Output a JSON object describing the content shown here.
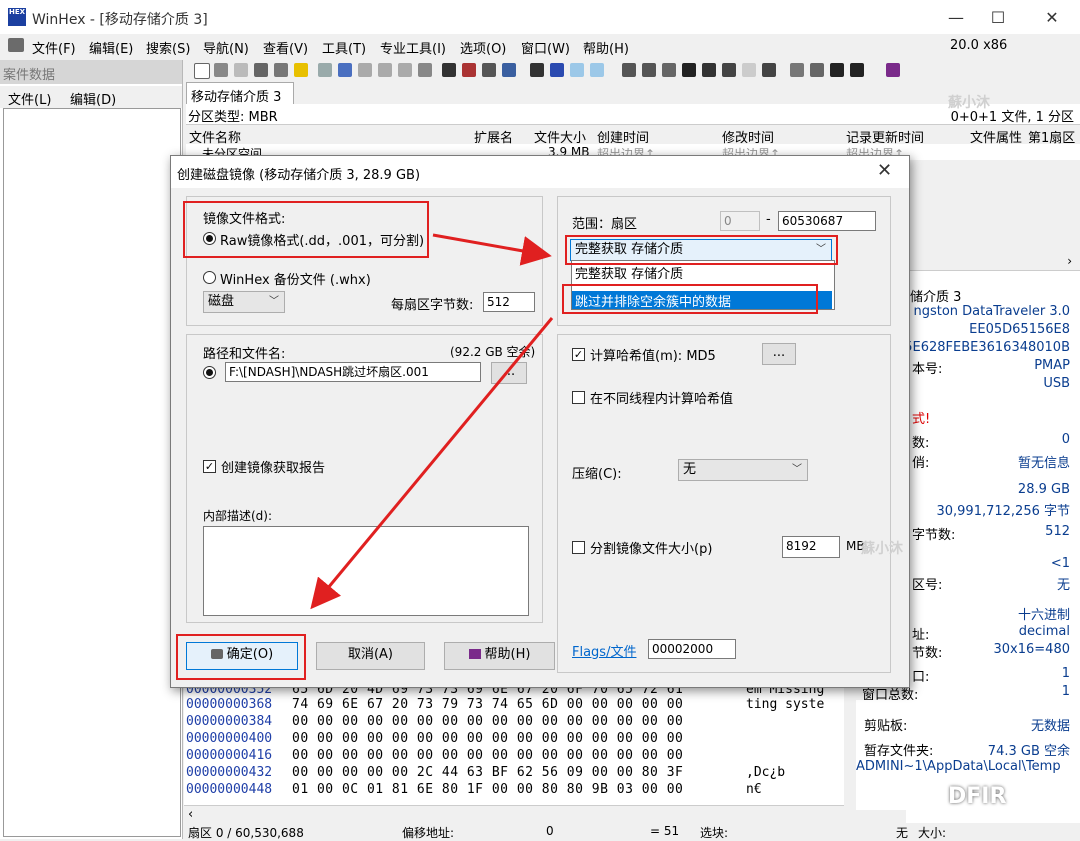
{
  "window": {
    "title": "WinHex - [移动存储介质 3]",
    "version": "20.0 x86",
    "logo": "HEX",
    "min": "—",
    "max": "☐",
    "close": "✕"
  },
  "menu": [
    "文件(F)",
    "编辑(E)",
    "搜索(S)",
    "导航(N)",
    "查看(V)",
    "工具(T)",
    "专业工具(I)",
    "选项(O)",
    "窗口(W)",
    "帮助(H)"
  ],
  "case": {
    "title": "案件数据",
    "menu_file": "文件(L)",
    "menu_edit": "编辑(D)"
  },
  "tab": {
    "label": "移动存储介质 3"
  },
  "partition": {
    "type_label": "分区类型: MBR",
    "summary": "0+0+1 文件, 1 分区"
  },
  "columns": [
    "文件名称",
    "扩展名",
    "文件大小",
    "创建时间",
    "修改时间",
    "记录更新时间",
    "文件属性",
    "第1扇区"
  ],
  "file_row": {
    "name": "未分区空间",
    "size": "3.9 MB",
    "ctime": "超出边界↑",
    "mtime": "超出边界↑",
    "rtime": "超出边界↑"
  },
  "watermarks": {
    "w1": "蘇小沐",
    "w2": "蘇小沐",
    "w3": "蘇小沐",
    "dfir": "DFIR"
  },
  "dialog": {
    "title": "创建磁盘镜像 (移动存储介质 3, 28.9 GB)",
    "close": "✕",
    "format_label": "镜像文件格式:",
    "raw_option": "Raw镜像格式(.dd，.001，可分割)",
    "whx_option": "WinHex 备份文件 (.whx)",
    "source_select": "磁盘",
    "bytes_per_sector_label": "每扇区字节数:",
    "bytes_per_sector": "512",
    "range_label": "范围：扇区",
    "range_start": "0",
    "range_dash": "-",
    "range_end": "60530687",
    "acquire_select": "完整获取 存储介质",
    "dropdown_options": [
      "完整获取 存储介质",
      "跳过并排除空余簇中的数据"
    ],
    "path_label": "路径和文件名:",
    "free_space": "(92.2 GB 空余)",
    "path_value": "F:\\[NDASH]\\NDASH跳过坏扇区.001",
    "browse": "...",
    "report_label": "创建镜像获取报告",
    "desc_label": "内部描述(d):",
    "hash_label": "计算哈希值(m): MD5",
    "hash_btn": "...",
    "thread_label": "在不同线程内计算哈希值",
    "compress_label": "压缩(C):",
    "compress_value": "无",
    "split_label": "分割镜像文件大小(p)",
    "split_value": "8192",
    "split_unit": "MB",
    "flags_label": "Flags/文件",
    "flags_value": "00002000",
    "ok": "确定(O)",
    "cancel": "取消(A)",
    "help": "帮助(H)"
  },
  "right_panel": {
    "media_name": "储介质 3",
    "model": "ngston DataTraveler 3.0",
    "serial1": "EE05D65156E8",
    "serial2": "5E628FEBE3616348010B",
    "ver_label": "本号:",
    "ver_value": "PMAP",
    "bus": "USB",
    "warn": "式!",
    "count_label": "数:",
    "count_value": "0",
    "info_label": "俏:",
    "info_value": "暂无信息",
    "size1": "28.9 GB",
    "size2": "30,991,712,256 字节",
    "bps_label": "字节数:",
    "bps_value": "512",
    "lt": "<1",
    "part_label": "区号:",
    "part_value": "无",
    "hex_label": "十六进制",
    "addr_label": "址:",
    "addr_value": "decimal",
    "width_label": "节数:",
    "width_value": "30x16=480",
    "win_label": "口:",
    "win_value": "1",
    "wintotal_label": "窗口总数:",
    "wintotal_value": "1",
    "clip_label": "剪贴板:",
    "clip_value": "无数据",
    "temp_label": "暂存文件夹:",
    "temp_value": "74.3 GB 空余",
    "temp_path": "ADMINI~1\\AppData\\Local\\Temp"
  },
  "hex_rows": [
    {
      "off": "00000000352",
      "bytes": "65 6D 20 4D 69 73 73 69   6E 67 20 6F 70 65 72 61",
      "ascii": "em Missing"
    },
    {
      "off": "00000000368",
      "bytes": "74 69 6E 67 20 73 79 73   74 65 6D 00 00 00 00 00",
      "ascii": "ting syste"
    },
    {
      "off": "00000000384",
      "bytes": "00 00 00 00 00 00 00 00   00 00 00 00 00 00 00 00",
      "ascii": ""
    },
    {
      "off": "00000000400",
      "bytes": "00 00 00 00 00 00 00 00   00 00 00 00 00 00 00 00",
      "ascii": ""
    },
    {
      "off": "00000000416",
      "bytes": "00 00 00 00 00 00 00 00   00 00 00 00 00 00 00 00",
      "ascii": ""
    },
    {
      "off": "00000000432",
      "bytes": "00 00 00 00 00 2C 44 63   BF 62 56 09 00 00 80 3F",
      "ascii": "    ,Dc¿b"
    },
    {
      "off": "00000000448",
      "bytes": "01 00 0C 01 81 6E 80 1F   00 00 80 80 9B 03 00 00",
      "ascii": "    n€"
    }
  ],
  "status": {
    "sector": "扇区 0 / 60,530,688",
    "offset_label": "偏移地址:",
    "offset_value": "0",
    "eq": "= 51",
    "sel_label": "选块:",
    "none": "无",
    "size_label": "大小:"
  },
  "colors": {
    "accent": "#1f3fa8",
    "highlight": "#0078d7",
    "annotation": "#e02020"
  }
}
